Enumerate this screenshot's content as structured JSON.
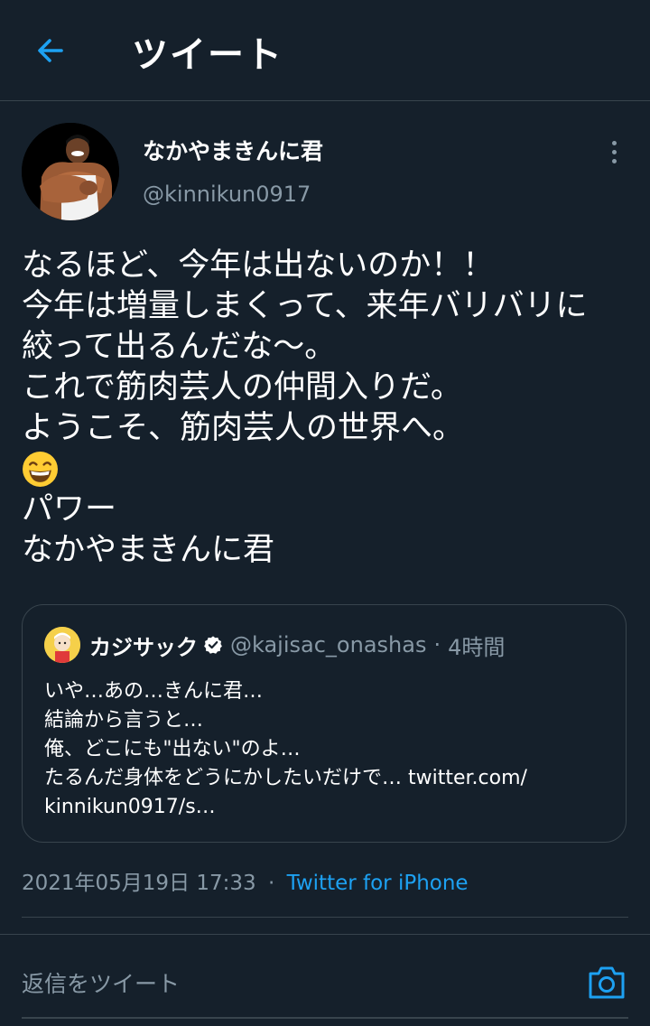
{
  "header": {
    "title": "ツイート",
    "back_icon": "back-arrow-icon"
  },
  "author": {
    "display_name": "なかやまきんに君",
    "handle": "@kinnikun0917",
    "avatar": "avatar-photo"
  },
  "tweet": {
    "lines": [
      "なるほど、今年は出ないのか！！",
      "今年は増量しまくって、来年バリバリに",
      "絞って出るんだな〜。",
      "これで筋肉芸人の仲間入りだ。",
      "ようこそ、筋肉芸人の世界へ。",
      "",
      "パワー",
      "なかやまきんに君"
    ],
    "emoji": "grinning-squinting-face-emoji"
  },
  "quote": {
    "name": "カジサック",
    "verified_icon": "verified-badge-icon",
    "handle": "@kajisac_onashas",
    "separator": "·",
    "time": "4時間",
    "lines": [
      "いや…あの…きんに君…",
      "結論から言うと…",
      "俺、どこにも\"出ない\"のよ…",
      "たるんだ身体をどうにかしたいだけで… twitter.com/",
      "kinnikun0917/s…"
    ]
  },
  "meta": {
    "date": "2021年05月19日 17:33",
    "separator": "·",
    "source": "Twitter for iPhone"
  },
  "reply": {
    "placeholder": "返信をツイート",
    "camera_icon": "camera-icon"
  },
  "colors": {
    "background": "#15202b",
    "accent": "#1da1f2",
    "secondary_text": "#8899a6",
    "divider": "#38444d"
  }
}
